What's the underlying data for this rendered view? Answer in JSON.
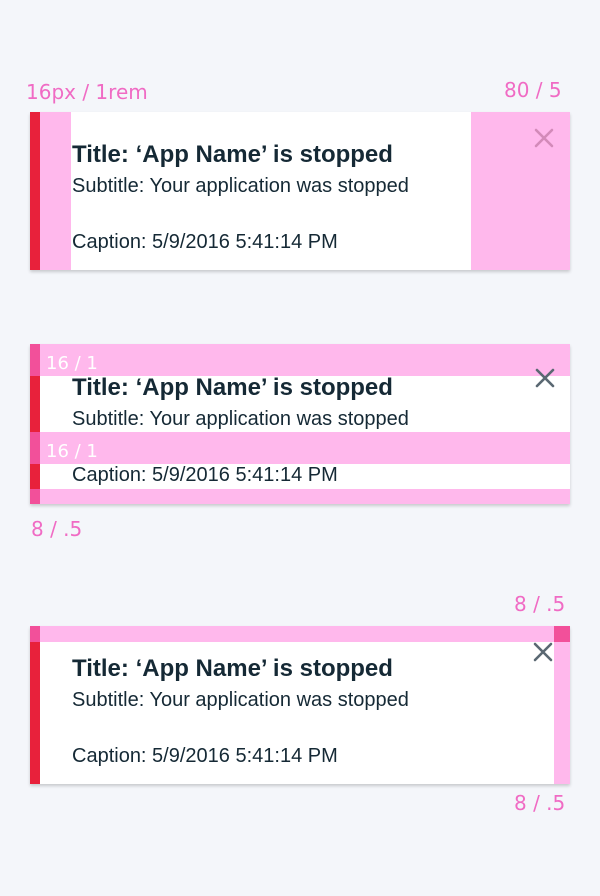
{
  "annotations": {
    "left_padding": "16px / 1rem",
    "right_padding": "80 / 5",
    "vertical_spacing_top": "16 / 1",
    "vertical_spacing_middle": "16 / 1",
    "bottom_spacing": "8 / .5",
    "close_top_spacing": "8 / .5",
    "close_right_spacing": "8 / .5"
  },
  "notifications": [
    {
      "title": "Title: ‘App Name’ is stopped",
      "subtitle": "Subtitle: Your application was stopped",
      "caption": "Caption: 5/9/2016 5:41:14 PM",
      "close_icon": "close-icon"
    },
    {
      "title": "Title: ‘App Name’ is stopped",
      "subtitle": "Subtitle: Your application was stopped",
      "caption": "Caption: 5/9/2016 5:41:14 PM",
      "close_icon": "close-icon"
    },
    {
      "title": "Title: ‘App Name’ is stopped",
      "subtitle": "Subtitle: Your application was stopped",
      "caption": "Caption: 5/9/2016 5:41:14 PM",
      "close_icon": "close-icon"
    }
  ],
  "colors": {
    "accent_error": "#e8213b",
    "spacing_highlight": "#ffb8ec",
    "annotation_text": "#f06bc4",
    "text": "#152935",
    "page_background": "#f4f6fa"
  }
}
